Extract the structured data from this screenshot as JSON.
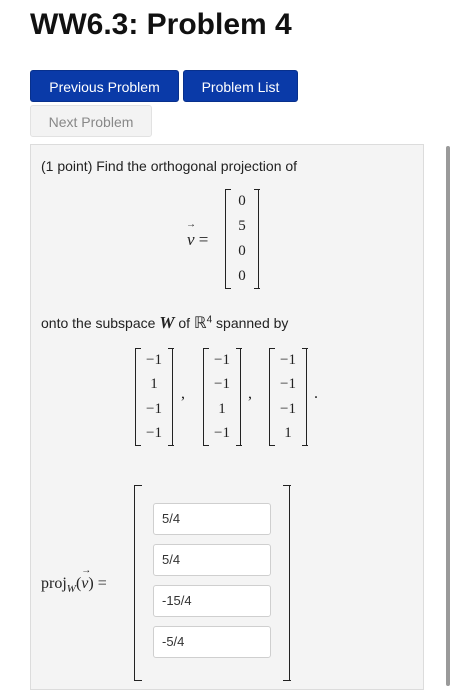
{
  "page_title": "WW6.3: Problem 4",
  "nav": {
    "previous_label": "Previous Problem",
    "list_label": "Problem List",
    "next_label": "Next Problem"
  },
  "problem": {
    "prompt": "(1 point) Find the orthogonal projection of",
    "vector_v": [
      "0",
      "5",
      "0",
      "0"
    ],
    "subspace_prefix": "onto the subspace",
    "subspace_var": "W",
    "subspace_of": "of",
    "space": "ℝ",
    "space_dim": "4",
    "subspace_suffix": "spanned by",
    "basis": [
      [
        "−1",
        "1",
        "−1",
        "−1"
      ],
      [
        "−1",
        "−1",
        "1",
        "−1"
      ],
      [
        "−1",
        "−1",
        "−1",
        "1"
      ]
    ],
    "proj_label": "proj",
    "proj_sub": "W",
    "answers": [
      "5/4",
      "5/4",
      "-15/4",
      "-5/4"
    ]
  },
  "colors": {
    "primary": "#0a3aa8",
    "panel": "#f4f4f4"
  }
}
